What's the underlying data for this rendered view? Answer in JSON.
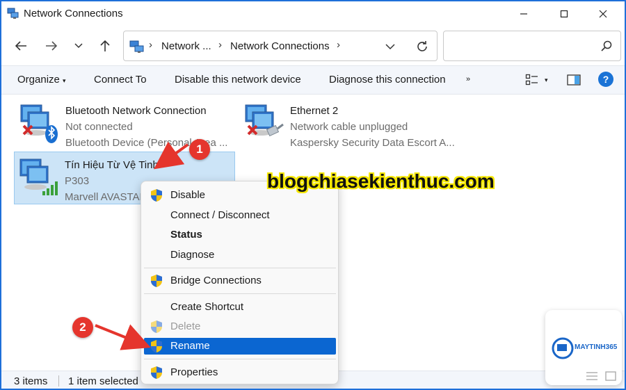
{
  "window": {
    "title": "Network Connections",
    "minimize_icon": "minimize-icon",
    "maximize_icon": "maximize-icon",
    "close_icon": "close-icon"
  },
  "nav": {
    "breadcrumb": [
      "Network ...",
      "Network Connections"
    ],
    "search_placeholder": ""
  },
  "commands": {
    "organize": "Organize",
    "connect_to": "Connect To",
    "disable_device": "Disable this network device",
    "diagnose": "Diagnose this connection",
    "more": "»"
  },
  "items": [
    {
      "name": "Bluetooth Network Connection",
      "status": "Not connected",
      "device": "Bluetooth Device (Personal Area ...",
      "selected": false
    },
    {
      "name": "Ethernet 2",
      "status": "Network cable unplugged",
      "device": "Kaspersky Security Data Escort A...",
      "selected": false
    },
    {
      "name": "Tín Hiệu Từ Vệ Tinh",
      "status": "P303",
      "device": "Marvell AVASTAR",
      "selected": true
    }
  ],
  "context_menu": {
    "disable": "Disable",
    "connect_disconnect": "Connect / Disconnect",
    "status": "Status",
    "diagnose": "Diagnose",
    "bridge": "Bridge Connections",
    "create_shortcut": "Create Shortcut",
    "delete": "Delete",
    "rename": "Rename",
    "properties": "Properties"
  },
  "statusbar": {
    "item_count": "3 items",
    "selected_count": "1 item selected"
  },
  "annotations": {
    "badge1": "1",
    "badge2": "2",
    "watermark": "blogchiasekienthuc.com",
    "logo_text": "MAYTINH365"
  },
  "colors": {
    "accent": "#1e6fd9",
    "selection": "#cce4f7",
    "menu_highlight": "#0b66d1",
    "badge": "#e5352d",
    "watermark_outline": "#f5e700"
  }
}
